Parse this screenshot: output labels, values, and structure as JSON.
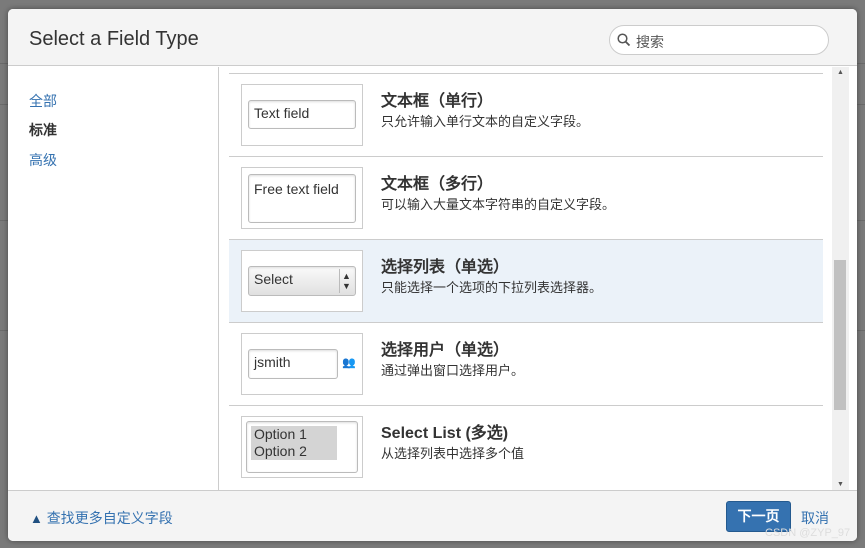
{
  "dialog": {
    "title": "Select a Field Type",
    "search_placeholder": "搜索"
  },
  "nav": {
    "items": [
      {
        "label": "全部"
      },
      {
        "label": "标准"
      },
      {
        "label": "高级"
      }
    ]
  },
  "fields": [
    {
      "title": "文本框（单行）",
      "desc": "只允许输入单行文本的自定义字段。",
      "preview": "Text field"
    },
    {
      "title": "文本框（多行）",
      "desc": "可以输入大量文本字符串的自定义字段。",
      "preview": "Free text field"
    },
    {
      "title": "选择列表（单选）",
      "desc": "只能选择一个选项的下拉列表选择器。",
      "preview": "Select"
    },
    {
      "title": "选择用户（单选）",
      "desc": "通过弹出窗口选择用户。",
      "preview": "jsmith"
    },
    {
      "title": "Select List (多选)",
      "desc": "从选择列表中选择多个值",
      "options": [
        "Option 1",
        "Option 2"
      ]
    }
  ],
  "footer": {
    "more_link": "查找更多自定义字段",
    "next": "下一页",
    "cancel": "取消"
  },
  "watermark": "CSDN @ZYP_97",
  "colors": {
    "accent": "#3572b0",
    "selected_row": "#ebf2f9"
  }
}
